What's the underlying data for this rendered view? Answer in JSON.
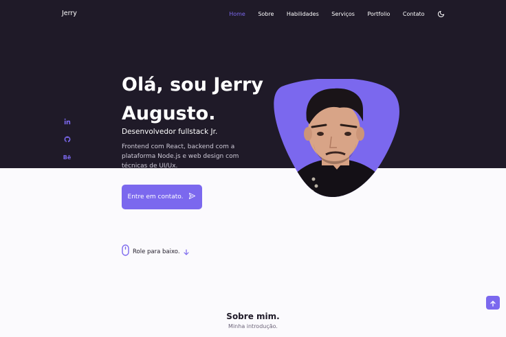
{
  "header": {
    "logo": "Jerry",
    "nav": [
      "Home",
      "Sobre",
      "Habilidades",
      "Serviços",
      "Portfolio",
      "Contato"
    ],
    "active": "Home"
  },
  "hero": {
    "greeting": "Olá, sou Jerry Augusto.",
    "subtitle": "Desenvolvedor fullstack Jr.",
    "description": "Frontend com React, backend com a plataforma Node.js e web design com técnicas de UI/Ux.",
    "cta_label": "Entre em contato.",
    "social": [
      "linkedin-icon",
      "github-icon",
      "behance-icon"
    ],
    "behance_text": "Bē"
  },
  "scroll": {
    "label": "Role para baixo."
  },
  "about": {
    "title": "Sobre mim.",
    "subtitle": "Minha introdução."
  },
  "colors": {
    "accent": "#7b68ee",
    "dark": "#1f1a28",
    "light": "#fbfafd"
  }
}
